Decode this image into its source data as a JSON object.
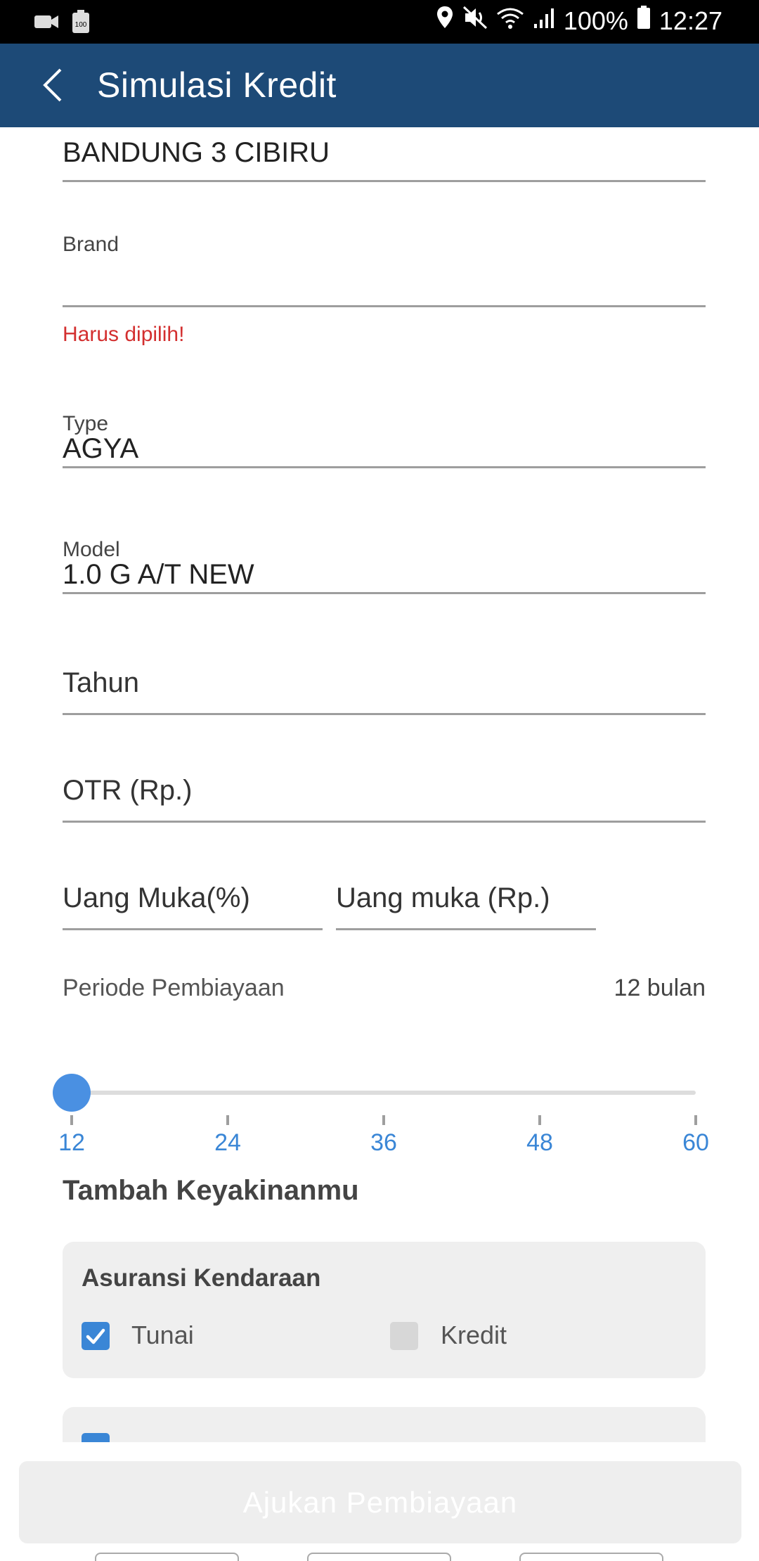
{
  "status_bar": {
    "battery_percent": "100%",
    "time": "12:27",
    "left_icons": [
      "video-camera-icon",
      "battery-saver-icon"
    ],
    "right_icons": [
      "location-icon",
      "mute-icon",
      "wifi-icon",
      "signal-icon",
      "battery-icon"
    ]
  },
  "app_bar": {
    "title": "Simulasi Kredit",
    "back_icon": "chevron-left-icon"
  },
  "form": {
    "dealer": {
      "value": "BANDUNG 3 CIBIRU"
    },
    "brand": {
      "label": "Brand",
      "value": "",
      "error": "Harus dipilih!"
    },
    "type": {
      "label": "Type",
      "value": "AGYA"
    },
    "model": {
      "label": "Model",
      "value": "1.0 G A/T NEW"
    },
    "tahun": {
      "placeholder": "Tahun"
    },
    "otr": {
      "placeholder": "OTR (Rp.)"
    },
    "dp_percent": {
      "placeholder": "Uang Muka(%)"
    },
    "dp_amount": {
      "placeholder": "Uang muka (Rp.)"
    }
  },
  "period": {
    "label": "Periode Pembiayaan",
    "value_text": "12 bulan",
    "selected": 12,
    "min": 12,
    "max": 60,
    "ticks": [
      "12",
      "24",
      "36",
      "48",
      "60"
    ]
  },
  "extras": {
    "title": "Tambah Keyakinanmu",
    "insurance_card": {
      "title": "Asuransi Kendaraan",
      "options": [
        {
          "label": "Tunai",
          "checked": true
        },
        {
          "label": "Kredit",
          "checked": false
        }
      ]
    },
    "second_card_checked": true
  },
  "submit": {
    "label": "Ajukan Pembiayaan"
  },
  "colors": {
    "app_bar": "#1d4a77",
    "accent": "#3a86d6",
    "error": "#d32f2f"
  }
}
